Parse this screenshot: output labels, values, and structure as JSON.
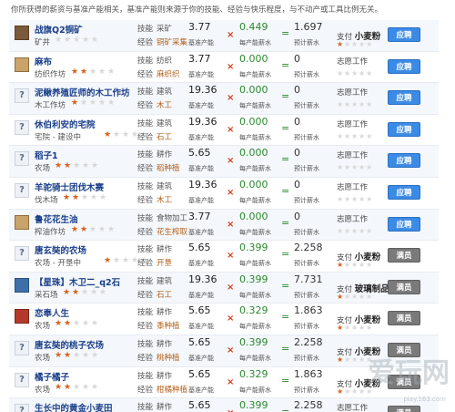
{
  "intro_text": "你所获得的薪资与基准产能相关，基准产能则来源于你的技能、经验与快乐程度，与不动产或工具比例无关。",
  "labels": {
    "skill": "技能",
    "exp": "经验",
    "base_capacity": "基准产能",
    "capacity_bonus": "每产能薪水",
    "total_pay": "预计薪水",
    "payer_prefix": "支付",
    "volunteer": "志愿工作",
    "apply_button": "应聘",
    "full_button": "满员"
  },
  "jobs": [
    {
      "name": "战旗Q2铜矿",
      "place": "矿井",
      "icon": "mine",
      "stars": 0,
      "skill": "采矿",
      "exp": "铜矿采集",
      "base": "3.77",
      "rate": "0.449",
      "total": "1.697",
      "payer": "小麦粉",
      "payer_stars": 1,
      "status": "apply"
    },
    {
      "name": "麻布",
      "place": "纺织作坊",
      "icon": "hammer",
      "stars": 2,
      "skill": "纺织",
      "exp": "麻织织",
      "base": "3.77",
      "rate": "0.000",
      "total": "0",
      "payer": "",
      "payer_stars": 0,
      "status": "apply"
    },
    {
      "name": "泥鳅养殖匠师的木工作坊",
      "place": "木工作坊",
      "icon": "question",
      "stars": 1,
      "skill": "建筑",
      "exp": "木工",
      "base": "19.36",
      "rate": "0.000",
      "total": "0",
      "payer": "",
      "payer_stars": 0,
      "status": "apply"
    },
    {
      "name": "休伯利安的宅院",
      "place": "宅院 - 建设中",
      "icon": "question",
      "stars": 1,
      "skill": "建筑",
      "exp": "石工",
      "base": "19.36",
      "rate": "0.000",
      "total": "0",
      "payer": "",
      "payer_stars": 0,
      "status": "apply"
    },
    {
      "name": "稻子1",
      "place": "农场",
      "icon": "question",
      "stars": 2,
      "skill": "耕作",
      "exp": "稻种植",
      "base": "5.65",
      "rate": "0.000",
      "total": "0",
      "payer": "",
      "payer_stars": 0,
      "status": "apply"
    },
    {
      "name": "羊驼骑士团伐木赛",
      "place": "伐木场",
      "icon": "question",
      "stars": 2,
      "skill": "建筑",
      "exp": "木工",
      "base": "19.36",
      "rate": "0.000",
      "total": "0",
      "payer": "",
      "payer_stars": 0,
      "status": "apply"
    },
    {
      "name": "鲁花花生油",
      "place": "榨油作坊",
      "icon": "hammer",
      "stars": 2,
      "skill": "食物加工",
      "exp": "花生榨取",
      "base": "3.77",
      "rate": "0.000",
      "total": "0",
      "payer": "",
      "payer_stars": 0,
      "status": "apply"
    },
    {
      "name": "唐玄奘的农场",
      "place": "农场 - 开垦中",
      "icon": "question",
      "stars": 1,
      "skill": "耕作",
      "exp": "开垦",
      "base": "5.65",
      "rate": "0.399",
      "total": "2.258",
      "payer": "小麦粉",
      "payer_stars": 1,
      "status": "full"
    },
    {
      "name": "【星珠】木卫二_q2石",
      "place": "采石场",
      "icon": "globe",
      "stars": 2,
      "skill": "建筑",
      "exp": "石工",
      "base": "19.36",
      "rate": "0.399",
      "total": "7.731",
      "payer": "玻璃制品",
      "payer_stars": 1,
      "status": "full"
    },
    {
      "name": "恋奉人生",
      "place": "农场",
      "icon": "banner",
      "stars": 2,
      "skill": "耕作",
      "exp": "黍种植",
      "base": "5.65",
      "rate": "0.329",
      "total": "1.863",
      "payer": "小麦粉",
      "payer_stars": 1,
      "status": "full"
    },
    {
      "name": "唐玄奘的桃子农场",
      "place": "农场",
      "icon": "question",
      "stars": 2,
      "skill": "耕作",
      "exp": "桃种植",
      "base": "5.65",
      "rate": "0.399",
      "total": "2.258",
      "payer": "小麦粉",
      "payer_stars": 1,
      "status": "full"
    },
    {
      "name": "橘子橘子",
      "place": "农场",
      "icon": "question",
      "stars": 2,
      "skill": "耕作",
      "exp": "柑橘种植",
      "base": "5.65",
      "rate": "0.329",
      "total": "1.863",
      "payer": "小麦粉",
      "payer_stars": 1,
      "status": "full"
    },
    {
      "name": "生长中的黄金小麦田",
      "place": "",
      "icon": "question",
      "stars": 0,
      "skill": "耕作",
      "exp": "",
      "base": "5.65",
      "rate": "0.399",
      "total": "2.258",
      "payer": "",
      "payer_stars": 0,
      "status": "full"
    }
  ],
  "watermark": {
    "main": "爱玩网",
    "sub": "play.163.com"
  },
  "colors": {
    "accent": "#3b8be6",
    "full": "#7a7a7a",
    "name": "#1a3f8a",
    "bonus": "#2b8a2e",
    "x": "#d23a1a"
  }
}
